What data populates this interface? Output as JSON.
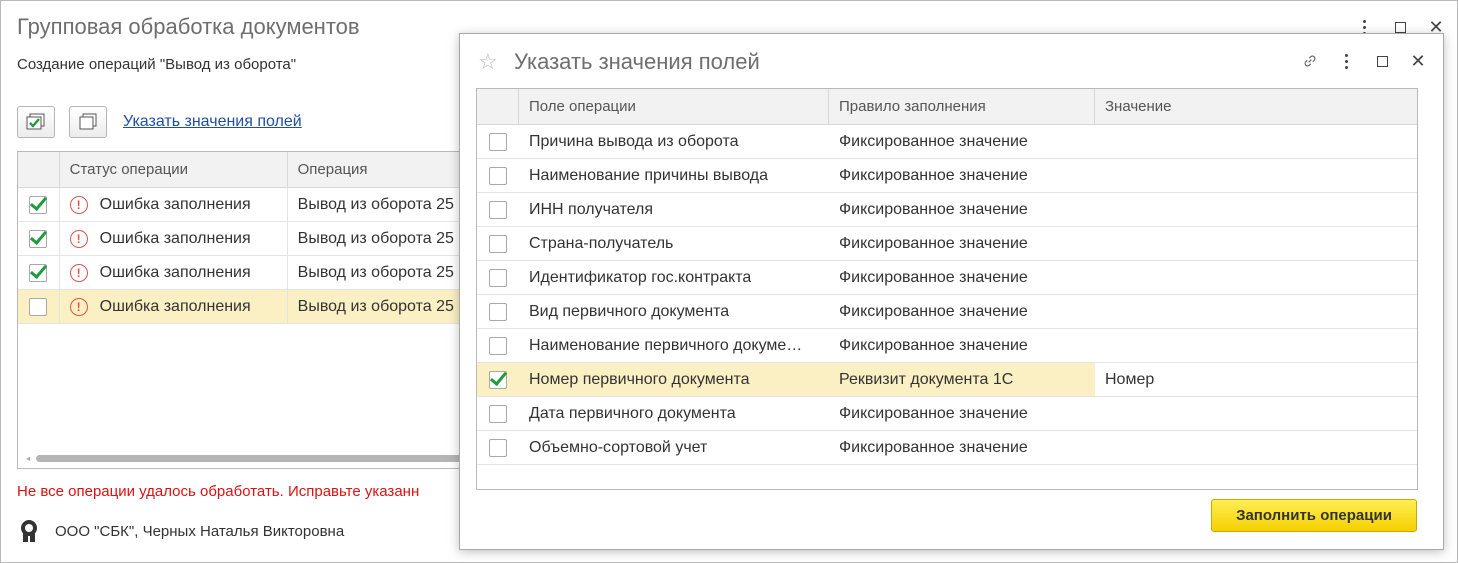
{
  "main": {
    "title": "Групповая обработка документов",
    "subtitle": "Создание операций \"Вывод из оборота\"",
    "toolbar": {
      "link_label": "Указать значения полей"
    },
    "grid": {
      "headers": [
        "",
        "Статус операции",
        "Операция"
      ],
      "rows": [
        {
          "checked": true,
          "status": "Ошибка заполнения",
          "operation": "Вывод из оборота 25"
        },
        {
          "checked": true,
          "status": "Ошибка заполнения",
          "operation": "Вывод из оборота 25"
        },
        {
          "checked": true,
          "status": "Ошибка заполнения",
          "operation": "Вывод из оборота 25"
        },
        {
          "checked": false,
          "status": "Ошибка заполнения",
          "operation": "Вывод из оборота 25",
          "selected": true
        }
      ]
    },
    "error_message": "Не все операции удалось обработать. Исправьте указанн",
    "organization": "ООО \"СБК\", Черных Наталья Викторовна"
  },
  "dialog": {
    "title": "Указать значения полей",
    "headers": [
      "",
      "Поле операции",
      "Правило заполнения",
      "Значение"
    ],
    "rows": [
      {
        "checked": false,
        "field": "Причина вывода из оборота",
        "rule": "Фиксированное значение",
        "value": ""
      },
      {
        "checked": false,
        "field": "Наименование причины вывода",
        "rule": "Фиксированное значение",
        "value": ""
      },
      {
        "checked": false,
        "field": "ИНН получателя",
        "rule": "Фиксированное значение",
        "value": ""
      },
      {
        "checked": false,
        "field": "Страна-получатель",
        "rule": "Фиксированное значение",
        "value": ""
      },
      {
        "checked": false,
        "field": "Идентификатор гос.контракта",
        "rule": "Фиксированное значение",
        "value": ""
      },
      {
        "checked": false,
        "field": "Вид первичного документа",
        "rule": "Фиксированное значение",
        "value": ""
      },
      {
        "checked": false,
        "field": "Наименование первичного докуме…",
        "rule": "Фиксированное значение",
        "value": ""
      },
      {
        "checked": true,
        "field": "Номер первичного документа",
        "rule": "Реквизит документа 1С",
        "value": "Номер",
        "selected": true
      },
      {
        "checked": false,
        "field": "Дата первичного документа",
        "rule": "Фиксированное значение",
        "value": ""
      },
      {
        "checked": false,
        "field": "Объемно-сортовой учет",
        "rule": "Фиксированное значение",
        "value": ""
      }
    ],
    "fill_button": "Заполнить операции"
  }
}
